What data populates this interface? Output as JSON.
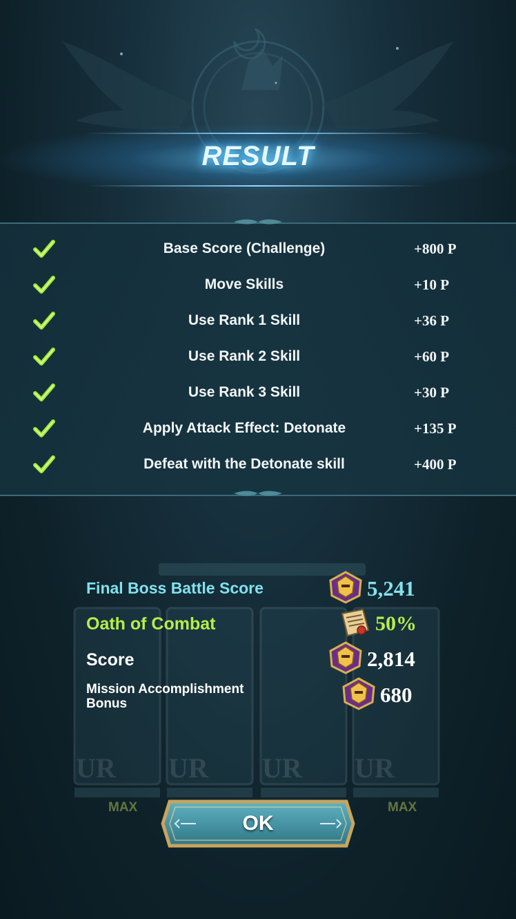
{
  "header": {
    "title": "RESULT"
  },
  "missions": [
    {
      "label": "Base Score (Challenge)",
      "points": "+800 P",
      "completed": true
    },
    {
      "label": "Move Skills",
      "points": "+10 P",
      "completed": true
    },
    {
      "label": "Use Rank 1 Skill",
      "points": "+36 P",
      "completed": true
    },
    {
      "label": "Use Rank 2 Skill",
      "points": "+60 P",
      "completed": true
    },
    {
      "label": "Use Rank 3 Skill",
      "points": "+30 P",
      "completed": true
    },
    {
      "label": "Apply Attack Effect: Detonate",
      "points": "+135 P",
      "completed": true
    },
    {
      "label": "Defeat with the Detonate skill",
      "points": "+400 P",
      "completed": true
    }
  ],
  "scores": {
    "final_label": "Final Boss Battle Score",
    "final_value": "5,241",
    "oath_label": "Oath of Combat",
    "oath_value": "50%",
    "score_label": "Score",
    "score_value": "2,814",
    "bonus_label": "Mission Accomplishment Bonus",
    "bonus_value": "680"
  },
  "background": {
    "max_left": "MAX",
    "max_right": "MAX"
  },
  "ok_button": {
    "label": "OK"
  },
  "colors": {
    "check": "#9be53a",
    "final_score": "#83e2ee",
    "oath": "#b6ee4a",
    "button_fill": "#3e8ea0",
    "button_frame": "#c9a45b"
  },
  "icons": {
    "check": "check-icon",
    "rank_crest": "helmet-crest-icon",
    "scroll": "scroll-icon"
  }
}
